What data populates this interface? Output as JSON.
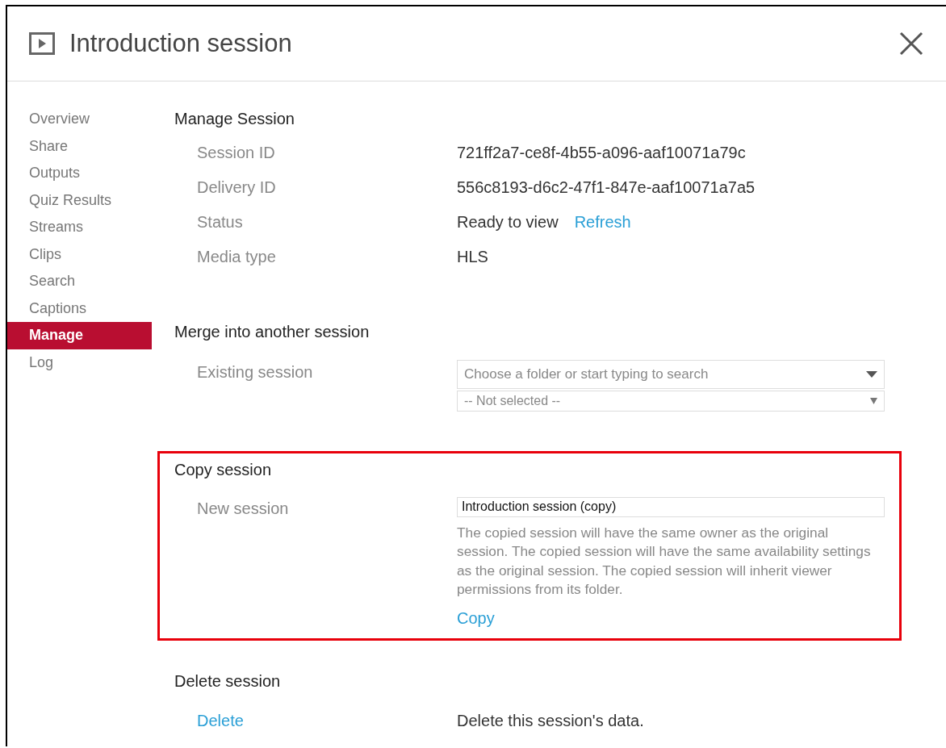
{
  "window": {
    "title": "Introduction session"
  },
  "sidebar": {
    "items": [
      {
        "label": "Overview",
        "selected": false
      },
      {
        "label": "Share",
        "selected": false
      },
      {
        "label": "Outputs",
        "selected": false
      },
      {
        "label": "Quiz Results",
        "selected": false
      },
      {
        "label": "Streams",
        "selected": false
      },
      {
        "label": "Clips",
        "selected": false
      },
      {
        "label": "Search",
        "selected": false
      },
      {
        "label": "Captions",
        "selected": false
      },
      {
        "label": "Manage",
        "selected": true
      },
      {
        "label": "Log",
        "selected": false
      }
    ]
  },
  "sections": [
    {
      "kind": "details",
      "heading": "Manage Session",
      "rows": [
        {
          "label": "Session ID",
          "value": "721ff2a7-ce8f-4b55-a096-aaf10071a79c"
        },
        {
          "label": "Delivery ID",
          "value": "556c8193-d6c2-47f1-847e-aaf10071a7a5"
        },
        {
          "label": "Status",
          "value": "Ready to view",
          "action": "Refresh"
        },
        {
          "label": "Media type",
          "value": "HLS"
        }
      ]
    },
    {
      "kind": "merge",
      "heading": "Merge into another session",
      "label": "Existing session",
      "search": {
        "placeholder": "Choose a folder or start typing to search"
      },
      "select": {
        "value": "-- Not selected --"
      }
    },
    {
      "kind": "copy",
      "heading": "Copy session",
      "highlighted": true,
      "label": "New session",
      "input": {
        "value": "Introduction session (copy)"
      },
      "help": "The copied session will have the same owner as the original session. The copied session will have the same availability settings as the original session. The copied session will inherit viewer permissions from its folder.",
      "action": "Copy"
    },
    {
      "kind": "delete",
      "heading": "Delete session",
      "action": "Delete",
      "description": "Delete this session's data."
    }
  ]
}
